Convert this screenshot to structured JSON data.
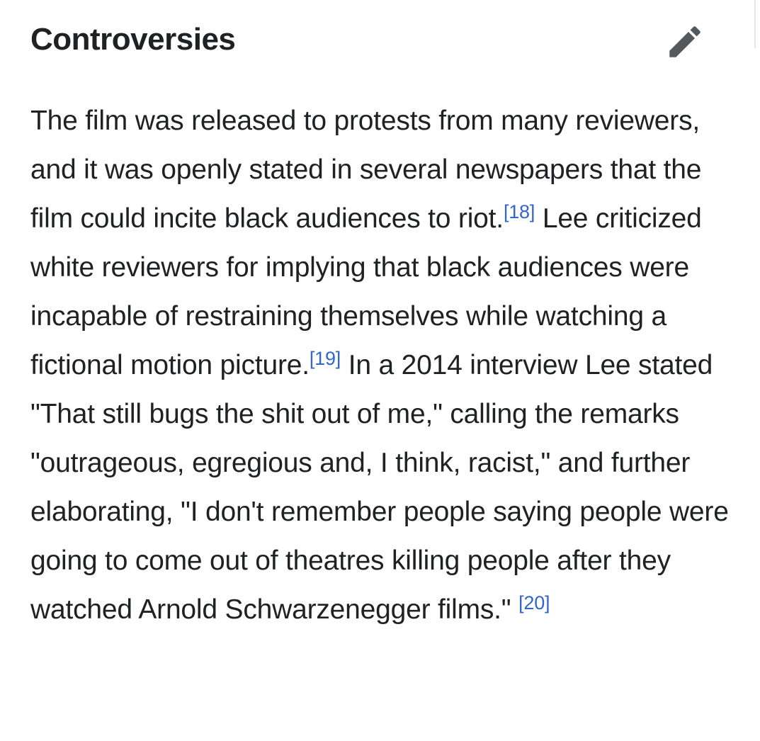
{
  "section": {
    "title": "Controversies",
    "edit_icon": "pencil-icon"
  },
  "paragraph": {
    "seg1": "The film was released to protests from many reviewers, and it was openly stated in several newspapers that the film could incite black audiences to riot.",
    "ref1": "[18]",
    "seg2": " Lee criticized white reviewers for implying that black audiences were incapable of restraining themselves while watching a fictional motion picture.",
    "ref2": "[19]",
    "seg3": " In a 2014 interview Lee stated \"That still bugs the shit out of me,\" calling the remarks \"outrageous, egregious and, I think, racist,\" and further elaborating, \"I don't remember people saying people were going to come out of theatres killing people after they watched Arnold Schwarzenegger films.\" ",
    "ref3": "[20]"
  },
  "colors": {
    "text": "#202122",
    "link": "#3366cc",
    "icon": "#54595d"
  }
}
